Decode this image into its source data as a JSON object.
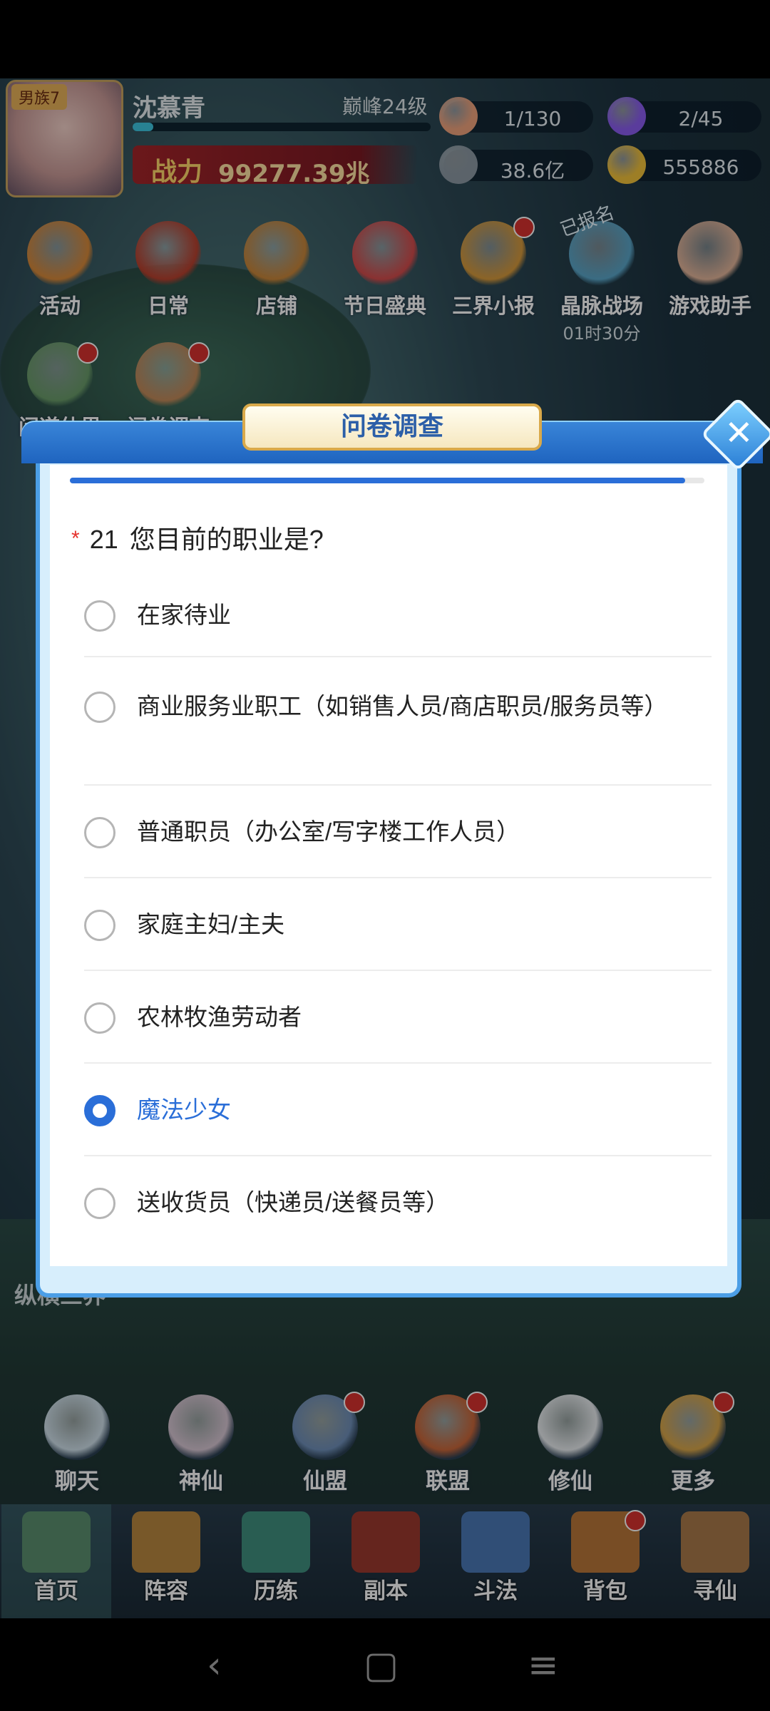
{
  "player": {
    "clan_tag": "男族7",
    "name": "沈慕青",
    "peak_level": "巅峰24级",
    "power_label": "战力",
    "power_value": "99277.39兆",
    "xp_fraction": 0.07
  },
  "resources": [
    {
      "name": "peach",
      "value": "1/130",
      "color": "#f0a37d"
    },
    {
      "name": "spirit-flame",
      "value": "2/45",
      "color": "#8a5df0"
    },
    {
      "name": "coin",
      "value": "38.6亿",
      "color": "#8c99a4"
    },
    {
      "name": "gold-ingot",
      "value": "555886",
      "color": "#f2c23b"
    }
  ],
  "top_icons": [
    {
      "label": "活动",
      "color": "#d8893a"
    },
    {
      "label": "日常",
      "color": "#b8412f"
    },
    {
      "label": "店铺",
      "color": "#c9863a"
    },
    {
      "label": "节日盛典",
      "color": "#d44c4c"
    },
    {
      "label": "三界小报",
      "color": "#d79a3c"
    },
    {
      "label": "晶脉战场",
      "color": "#5aa6c9",
      "ribbon": "已报名",
      "sub": "01时30分"
    },
    {
      "label": "游戏助手",
      "color": "#e3b59a"
    }
  ],
  "second_row_icons": [
    {
      "label": "问道仙界",
      "color": "#6a9c6a"
    },
    {
      "label": "问卷调查",
      "color": "#c28a5a"
    }
  ],
  "side_label": "纵横三界",
  "survey": {
    "title": "问卷调查",
    "close_label": "✕",
    "progress": 0.97,
    "required_mark": "*",
    "question_number": "21",
    "question_text": "您目前的职业是?",
    "options": [
      {
        "text": "在家待业",
        "selected": false
      },
      {
        "text": "商业服务业职工（如销售人员/商店职员/服务员等）",
        "selected": false
      },
      {
        "text": "普通职员（办公室/写字楼工作人员）",
        "selected": false
      },
      {
        "text": "家庭主妇/主夫",
        "selected": false
      },
      {
        "text": "农林牧渔劳动者",
        "selected": false
      },
      {
        "text": "魔法少女",
        "selected": true
      },
      {
        "text": "送收货员（快递员/送餐员等）",
        "selected": false
      }
    ]
  },
  "social_nav": [
    {
      "label": "聊天",
      "color": "#cfe0ea"
    },
    {
      "label": "神仙",
      "color": "#d8c7d4"
    },
    {
      "label": "仙盟",
      "color": "#6f8fb8"
    },
    {
      "label": "联盟",
      "color": "#c9673a"
    },
    {
      "label": "修仙",
      "color": "#e8ecef"
    },
    {
      "label": "更多",
      "color": "#d9a64a"
    }
  ],
  "bottom_tabs": [
    {
      "label": "首页"
    },
    {
      "label": "阵容"
    },
    {
      "label": "历练"
    },
    {
      "label": "副本"
    },
    {
      "label": "斗法"
    },
    {
      "label": "背包"
    },
    {
      "label": "寻仙"
    }
  ],
  "system_nav": {
    "back": "‹",
    "home": "▢",
    "menu": "≡"
  }
}
